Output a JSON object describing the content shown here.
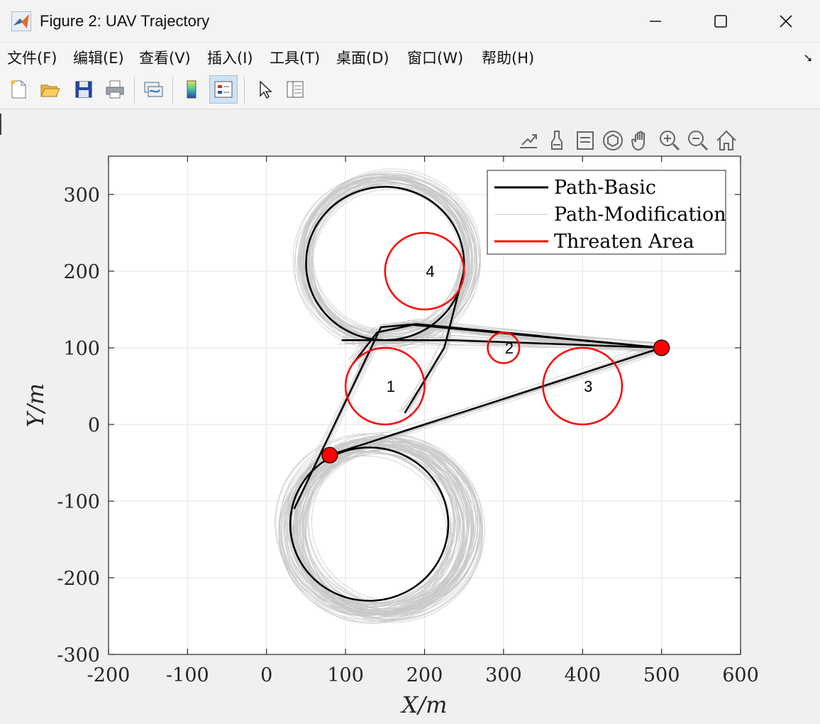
{
  "window": {
    "title": "Figure 2: UAV Trajectory"
  },
  "menu": [
    "文件(F)",
    "编辑(E)",
    "查看(V)",
    "插入(I)",
    "工具(T)",
    "桌面(D)",
    "窗口(W)",
    "帮助(H)"
  ],
  "toolbar": [
    "new-figure",
    "open-file",
    "save",
    "print",
    "link-plot",
    "colorbar",
    "legend",
    "select-pointer",
    "property-inspector"
  ],
  "axes_toolbar": [
    "export",
    "brush",
    "data-tips",
    "rotate-3d",
    "pan",
    "zoom-in",
    "zoom-out",
    "home"
  ],
  "colors": {
    "basic": "#000000",
    "modification": "#c8c8c8",
    "threat": "#ff0000"
  },
  "chart_data": {
    "type": "line",
    "xlabel": "X/m",
    "ylabel": "Y/m",
    "xlim": [
      -200,
      600
    ],
    "ylim": [
      -300,
      350
    ],
    "xticks": [
      "-200",
      "-100",
      "0",
      "100",
      "200",
      "300",
      "400",
      "500",
      "600"
    ],
    "yticks": [
      "-300",
      "-200",
      "-100",
      "0",
      "100",
      "200",
      "300"
    ],
    "grid": true,
    "legend": {
      "position": "top-right",
      "entries": [
        "Path-Basic",
        "Path-Modification",
        "Threaten Area"
      ]
    },
    "threat_areas": [
      {
        "label": "1",
        "cx": 150,
        "cy": 50,
        "r": 50
      },
      {
        "label": "2",
        "cx": 300,
        "cy": 100,
        "r": 20
      },
      {
        "label": "3",
        "cx": 400,
        "cy": 50,
        "r": 50
      },
      {
        "label": "4",
        "cx": 200,
        "cy": 200,
        "r": 50
      }
    ],
    "waypoints": [
      {
        "x": 80,
        "y": -40
      },
      {
        "x": 500,
        "y": 100
      }
    ],
    "series": [
      {
        "name": "Path-Basic",
        "segments": [
          {
            "type": "line",
            "points": [
              [
                80,
                -40
              ],
              [
                500,
                100
              ]
            ]
          },
          {
            "type": "circle",
            "cx": 130,
            "cy": -130,
            "r": 100
          },
          {
            "type": "line",
            "points": [
              [
                35,
                -110
              ],
              [
                145,
                127
              ],
              [
                190,
                131
              ],
              [
                500,
                100
              ]
            ]
          },
          {
            "type": "line",
            "points": [
              [
                95,
                110
              ],
              [
                230,
                110
              ],
              [
                500,
                100
              ]
            ]
          },
          {
            "type": "line",
            "points": [
              [
                175,
                15
              ],
              [
                225,
                100
              ],
              [
                250,
                200
              ]
            ]
          },
          {
            "type": "circle",
            "cx": 150,
            "cy": 210,
            "r": 100
          },
          {
            "type": "line",
            "points": [
              [
                110,
                80
              ],
              [
                140,
                120
              ],
              [
                185,
                130
              ],
              [
                290,
                120
              ],
              [
                500,
                100
              ]
            ]
          }
        ]
      },
      {
        "name": "Path-Modification",
        "clusters": [
          {
            "cx": 135,
            "cy": -135,
            "r": 110,
            "spread_x": 40,
            "spread_y": 20
          },
          {
            "cx": 150,
            "cy": 215,
            "r": 105,
            "spread_x": 20,
            "spread_y": 15
          }
        ]
      }
    ]
  }
}
